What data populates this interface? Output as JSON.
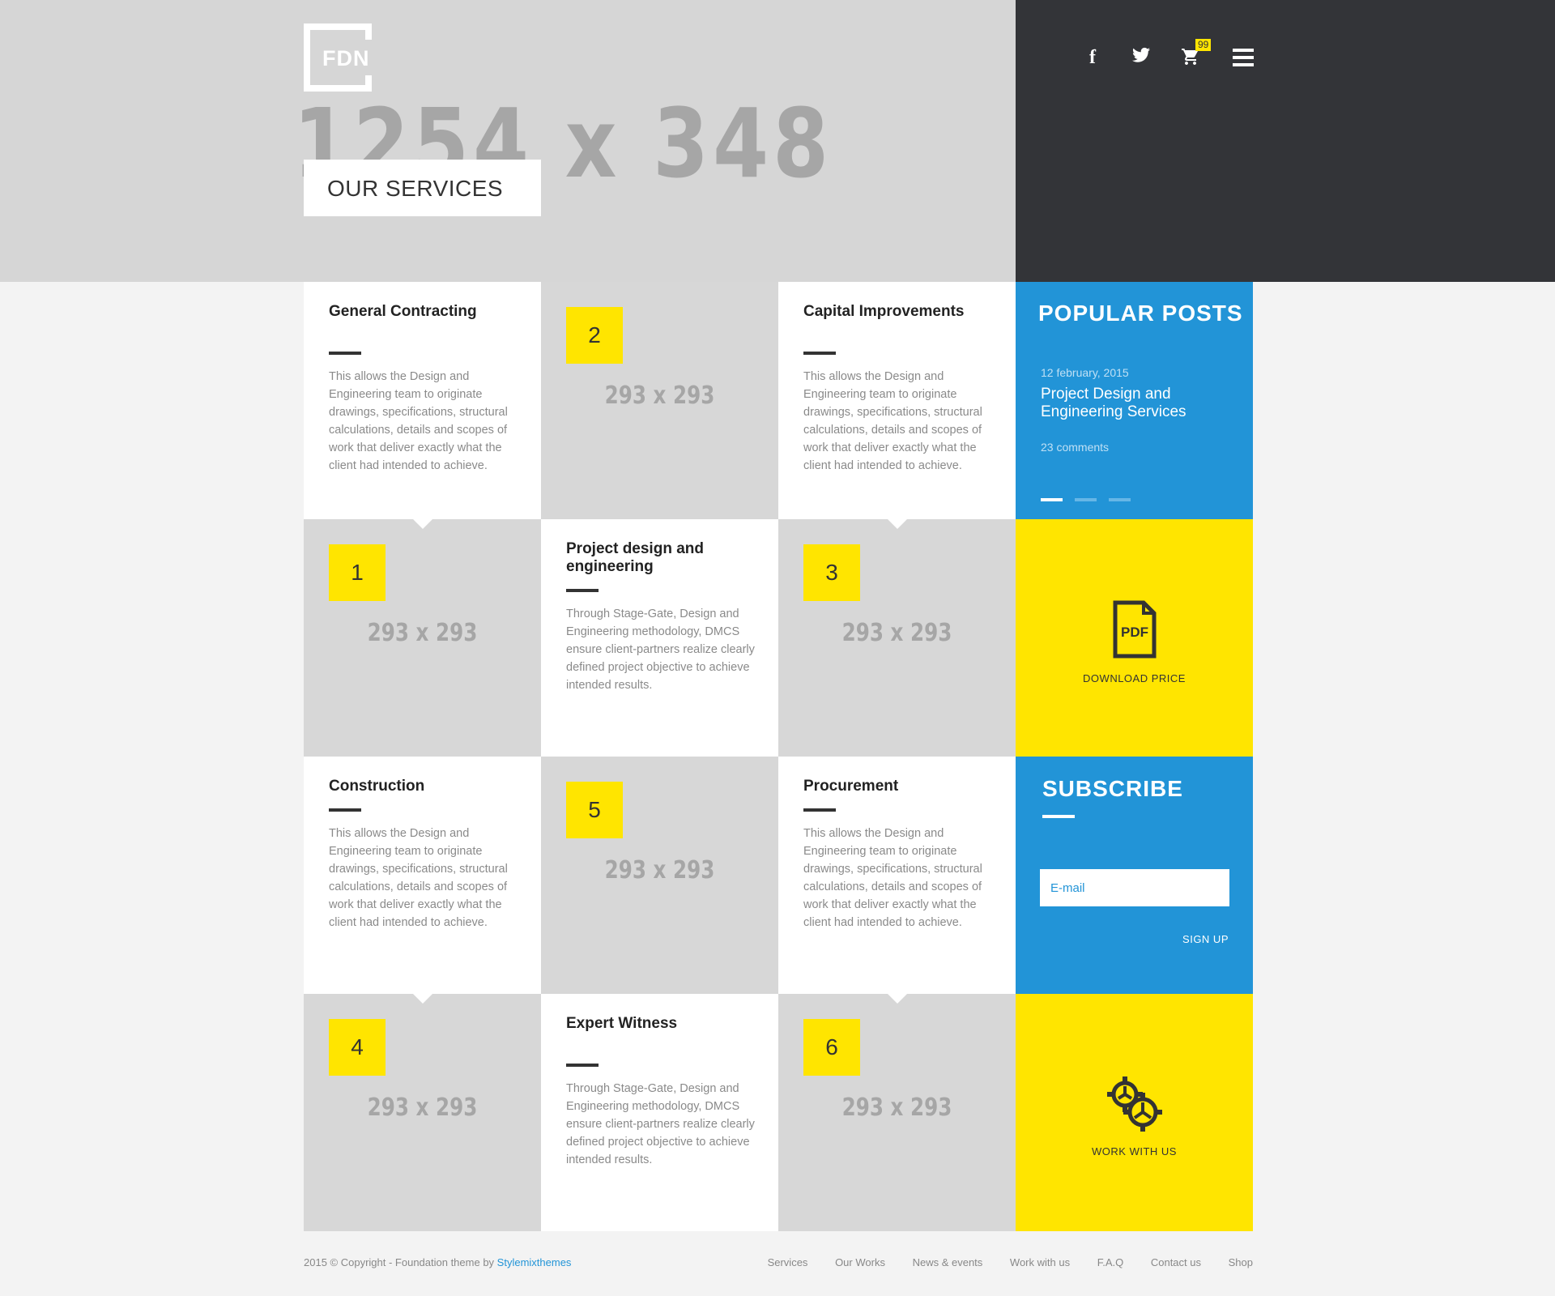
{
  "header": {
    "logo_text": "FDN",
    "placeholder_dim": "1254 x 348",
    "page_title": "OUR SERVICES",
    "cart_count": "99"
  },
  "services": [
    {
      "title": "General Contracting",
      "text": "This allows the Design and Engineering team to originate drawings, specifications, structural calculations, details and scopes of work that deliver exactly what the client had intended to achieve."
    },
    {
      "number": "2",
      "dim": "293 x 293"
    },
    {
      "title": "Capital Improvements",
      "text": "This allows the Design and Engineering team to originate drawings, specifications, structural calculations, details and scopes of work that deliver exactly what the client had intended to achieve."
    },
    {
      "number": "1",
      "dim": "293 x 293"
    },
    {
      "title": "Project design and engineering",
      "text": "Through Stage-Gate, Design and Engineering methodology, DMCS ensure client-partners realize clearly defined project objective to achieve intended results."
    },
    {
      "number": "3",
      "dim": "293 x 293"
    },
    {
      "title": "Construction",
      "text": "This allows the Design and Engineering team to originate drawings, specifications, structural calculations, details and scopes of work that deliver exactly what the client had intended to achieve."
    },
    {
      "number": "5",
      "dim": "293 x 293"
    },
    {
      "title": "Procurement",
      "text": "This allows the Design and Engineering team to originate drawings, specifications, structural calculations, details and scopes of work that deliver exactly what the client had intended to achieve."
    },
    {
      "number": "4",
      "dim": "293 x 293"
    },
    {
      "title": "Expert Witness",
      "text": "Through Stage-Gate, Design and Engineering methodology, DMCS ensure client-partners realize clearly defined project objective to achieve intended results."
    },
    {
      "number": "6",
      "dim": "293 x 293"
    }
  ],
  "popular_posts": {
    "title": "POPULAR POSTS",
    "date": "12 february, 2015",
    "post_title": "Project Design and Engineering Services",
    "comments": "23 comments"
  },
  "download": {
    "icon_text": "PDF",
    "label": "DOWNLOAD PRICE"
  },
  "subscribe": {
    "title": "SUBSCRIBE",
    "email_placeholder": "E-mail",
    "button": "SIGN UP"
  },
  "work": {
    "label": "WORK WITH US"
  },
  "footer": {
    "copyright": "2015 © Copyright - Foundation theme by ",
    "author": "Stylemixthemes",
    "nav": [
      "Services",
      "Our Works",
      "News & events",
      "Work with us",
      "F.A.Q",
      "Contact us",
      "Shop"
    ]
  },
  "colors": {
    "accent_yellow": "#ffe500",
    "accent_blue": "#2294d7",
    "dark": "#333438"
  }
}
